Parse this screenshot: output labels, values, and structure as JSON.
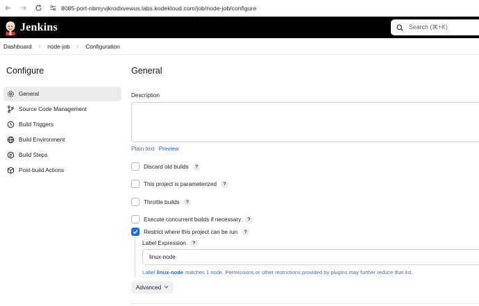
{
  "browser": {
    "url": "8085-port-nbmyvjkrodxvewus.labs.kodekloud.com/job/node-job/configure"
  },
  "header": {
    "title": "Jenkins",
    "search_placeholder": "Search (⌘+K)"
  },
  "breadcrumb": [
    "Dashboard",
    "node-job",
    "Configuration"
  ],
  "sidebar": {
    "title": "Configure",
    "items": [
      {
        "label": "General",
        "icon": "gear-icon",
        "active": true
      },
      {
        "label": "Source Code Management",
        "icon": "branch-icon",
        "active": false
      },
      {
        "label": "Build Triggers",
        "icon": "clock-icon",
        "active": false
      },
      {
        "label": "Build Environment",
        "icon": "globe-icon",
        "active": false
      },
      {
        "label": "Build Steps",
        "icon": "list-icon",
        "active": false
      },
      {
        "label": "Post-build Actions",
        "icon": "package-icon",
        "active": false
      }
    ]
  },
  "main": {
    "title": "General",
    "description": {
      "label": "Description",
      "value": "",
      "plain_text": "Plain text",
      "preview": "Preview"
    },
    "options": [
      {
        "label": "Discard old builds",
        "checked": false
      },
      {
        "label": "This project is parameterized",
        "checked": false
      },
      {
        "label": "Throttle builds",
        "checked": false
      },
      {
        "label": "Execute concurrent builds if necessary",
        "checked": false
      },
      {
        "label": "Restrict where this project can be run",
        "checked": true
      }
    ],
    "help_glyph": "?",
    "label_expression": {
      "label": "Label Expression",
      "value": "linux-node",
      "hint_prefix": "Label",
      "hint_link": "linux-node",
      "hint_suffix": "matches 1 node. Permissions or other restrictions provided by plugins may further reduce that list."
    },
    "advanced_label": "Advanced"
  },
  "colors": {
    "header_bg": "#000000",
    "accent": "#1f6fd6",
    "link": "#2563c5"
  }
}
